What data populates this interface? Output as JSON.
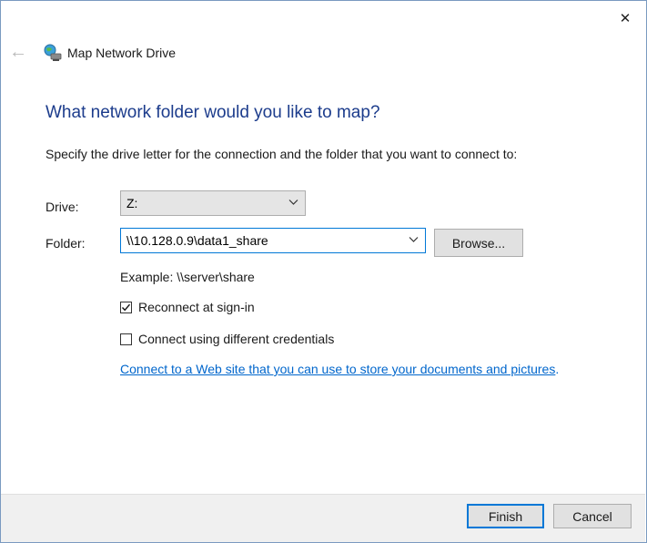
{
  "window": {
    "close_glyph": "✕",
    "back_glyph": "←",
    "title": "Map Network Drive"
  },
  "heading": "What network folder would you like to map?",
  "instruction": "Specify the drive letter for the connection and the folder that you want to connect to:",
  "drive": {
    "label": "Drive:",
    "value": "Z:"
  },
  "folder": {
    "label": "Folder:",
    "value": "\\\\10.128.0.9\\data1_share",
    "browse_label": "Browse..."
  },
  "example": "Example: \\\\server\\share",
  "options": {
    "reconnect": {
      "label": "Reconnect at sign-in",
      "checked": true
    },
    "credentials": {
      "label": "Connect using different credentials",
      "checked": false
    }
  },
  "link": {
    "text": "Connect to a Web site that you can use to store your documents and pictures",
    "suffix": "."
  },
  "footer": {
    "finish_label": "Finish",
    "cancel_label": "Cancel"
  },
  "colors": {
    "heading": "#1c3c8c",
    "link": "#0066cc",
    "focus": "#0078d7"
  }
}
